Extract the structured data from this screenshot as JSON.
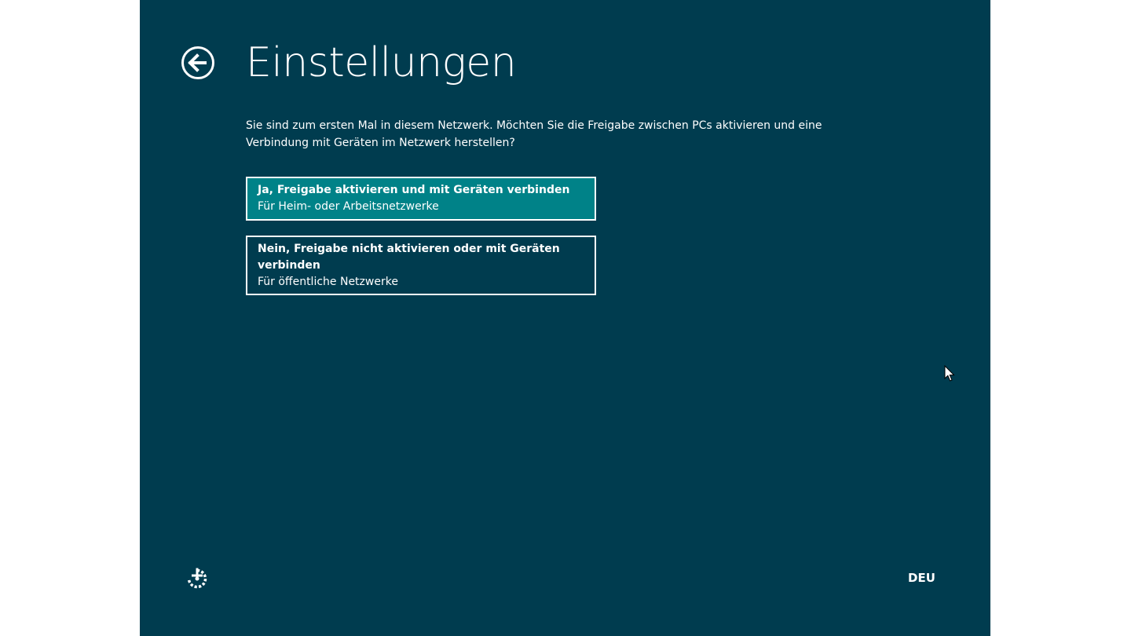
{
  "header": {
    "title": "Einstellungen",
    "back_icon": "back-arrow-circle-icon"
  },
  "main": {
    "description": "Sie sind zum ersten Mal in diesem Netzwerk. Möchten Sie die Freigabe zwischen PCs aktivieren und eine Verbindung mit Geräten im Netzwerk herstellen?",
    "options": [
      {
        "title": "Ja, Freigabe aktivieren und mit Geräten verbinden",
        "subtitle": "Für Heim- oder Arbeitsnetzwerke",
        "selected": true
      },
      {
        "title": "Nein, Freigabe nicht aktivieren oder mit Geräten verbinden",
        "subtitle": "Für öffentliche Netzwerke",
        "selected": false
      }
    ]
  },
  "footer": {
    "accessibility_icon": "ease-of-access-icon",
    "language": "DEU"
  },
  "colors": {
    "background": "#003c4f",
    "selected_option": "#008288",
    "outer_background": "#ffffff",
    "foreground": "#ffffff"
  }
}
